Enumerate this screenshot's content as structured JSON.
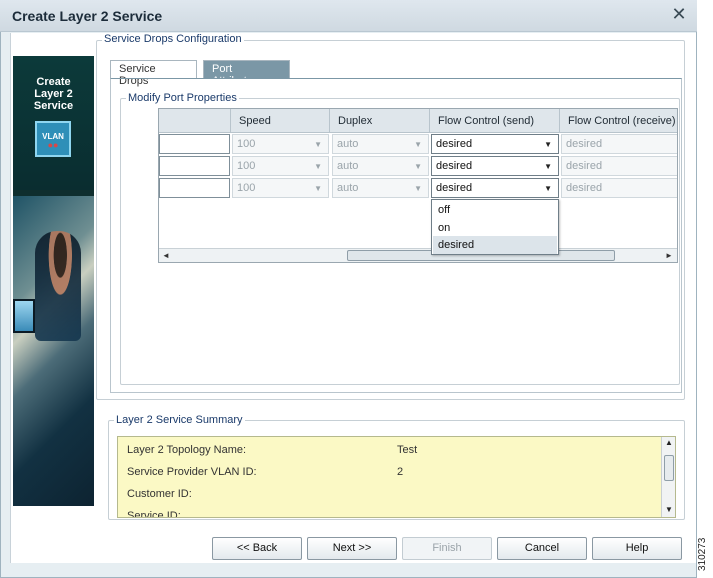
{
  "window": {
    "title": "Create Layer 2 Service",
    "close_glyph": "✕"
  },
  "banner": {
    "line1": "Create",
    "line2": "Layer 2",
    "line3": "Service",
    "icon_label": "VLAN"
  },
  "config": {
    "group_title": "Service Drops Configuration",
    "tabs": [
      {
        "label": "Service Drops",
        "active": false
      },
      {
        "label": "Port Attributes",
        "active": true
      }
    ],
    "modify_title": "Modify Port Properties",
    "columns": [
      "",
      "Speed",
      "Duplex",
      "Flow Control (send)",
      "Flow Control (receive)"
    ],
    "rows": [
      {
        "name": "",
        "speed": "100",
        "duplex": "auto",
        "fc_send": "desired",
        "fc_receive": "desired"
      },
      {
        "name": "",
        "speed": "100",
        "duplex": "auto",
        "fc_send": "desired",
        "fc_receive": "desired"
      },
      {
        "name": "",
        "speed": "100",
        "duplex": "auto",
        "fc_send": "desired",
        "fc_receive": "desired"
      }
    ],
    "dropdown_options": [
      "off",
      "on",
      "desired"
    ],
    "dropdown_selected": "desired"
  },
  "summary": {
    "title": "Layer 2 Service Summary",
    "rows": [
      {
        "label": "Layer 2 Topology Name:",
        "value": "Test"
      },
      {
        "label": "Service Provider VLAN ID:",
        "value": "2"
      },
      {
        "label": "Customer ID:",
        "value": ""
      },
      {
        "label": "Service ID:",
        "value": ""
      }
    ]
  },
  "buttons": {
    "back": "<< Back",
    "next": "Next >>",
    "finish": "Finish",
    "cancel": "Cancel",
    "help": "Help"
  },
  "watermark": "310273",
  "colors": {
    "tab_active": "#7b97a6",
    "summary_bg": "#fbf9c5",
    "legend_text": "#1a3a6a"
  }
}
